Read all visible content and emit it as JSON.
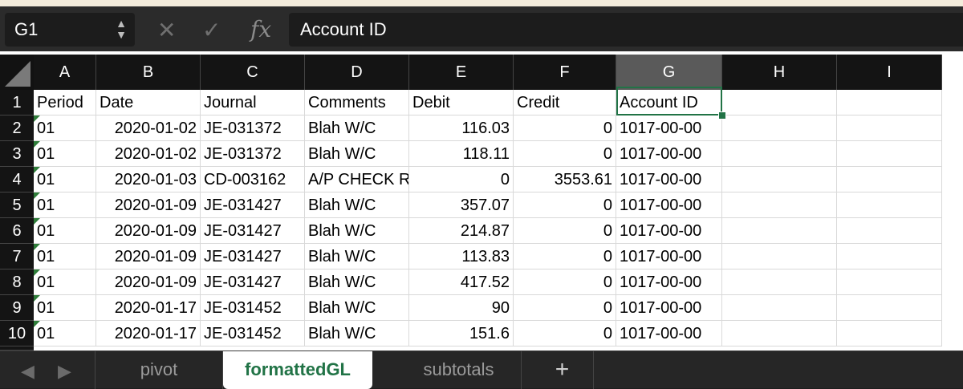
{
  "formula_bar": {
    "name_box": "G1",
    "fx_label": "fx",
    "formula": "Account ID",
    "cancel_icon": "x-icon",
    "confirm_icon": "check-icon"
  },
  "columns": [
    "A",
    "B",
    "C",
    "D",
    "E",
    "F",
    "G",
    "H",
    "I"
  ],
  "selected_column": "G",
  "row_numbers": [
    "1",
    "2",
    "3",
    "4",
    "5",
    "6",
    "7",
    "8",
    "9",
    "10"
  ],
  "headers": {
    "period": "Period",
    "date": "Date",
    "journal": "Journal",
    "comments": "Comments",
    "debit": "Debit",
    "credit": "Credit",
    "account_id": "Account ID"
  },
  "rows": [
    {
      "period": "01",
      "date": "2020-01-02",
      "journal": "JE-031372",
      "comments": "Blah W/C",
      "debit": "116.03",
      "credit": "0",
      "account": "1017-00-00"
    },
    {
      "period": "01",
      "date": "2020-01-02",
      "journal": "JE-031372",
      "comments": "Blah W/C",
      "debit": "118.11",
      "credit": "0",
      "account": "1017-00-00"
    },
    {
      "period": "01",
      "date": "2020-01-03",
      "journal": "CD-003162",
      "comments": "A/P CHECK R",
      "debit": "0",
      "credit": "3553.61",
      "account": "1017-00-00"
    },
    {
      "period": "01",
      "date": "2020-01-09",
      "journal": "JE-031427",
      "comments": "Blah W/C",
      "debit": "357.07",
      "credit": "0",
      "account": "1017-00-00"
    },
    {
      "period": "01",
      "date": "2020-01-09",
      "journal": "JE-031427",
      "comments": "Blah W/C",
      "debit": "214.87",
      "credit": "0",
      "account": "1017-00-00"
    },
    {
      "period": "01",
      "date": "2020-01-09",
      "journal": "JE-031427",
      "comments": "Blah W/C",
      "debit": "113.83",
      "credit": "0",
      "account": "1017-00-00"
    },
    {
      "period": "01",
      "date": "2020-01-09",
      "journal": "JE-031427",
      "comments": "Blah W/C",
      "debit": "417.52",
      "credit": "0",
      "account": "1017-00-00"
    },
    {
      "period": "01",
      "date": "2020-01-17",
      "journal": "JE-031452",
      "comments": "Blah W/C",
      "debit": "90",
      "credit": "0",
      "account": "1017-00-00"
    },
    {
      "period": "01",
      "date": "2020-01-17",
      "journal": "JE-031452",
      "comments": "Blah W/C",
      "debit": "151.6",
      "credit": "0",
      "account": "1017-00-00"
    }
  ],
  "sheet_tabs": [
    {
      "label": "pivot",
      "active": false
    },
    {
      "label": "formattedGL",
      "active": true
    },
    {
      "label": "subtotals",
      "active": false
    }
  ],
  "add_sheet": "+",
  "colors": {
    "accent": "#217346",
    "header_bg": "#141414",
    "selected_header": "#5a5a5a"
  }
}
